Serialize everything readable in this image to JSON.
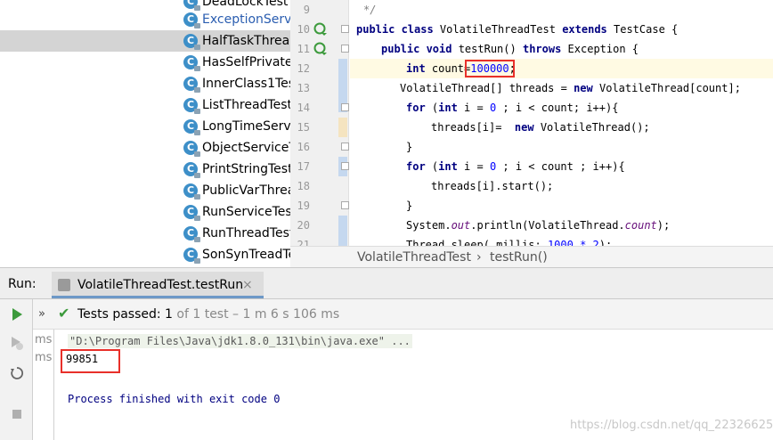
{
  "project_tree": {
    "items": [
      {
        "label": "DeadLockTest",
        "blue": false,
        "selected": false
      },
      {
        "label": "ExceptionServi",
        "blue": true,
        "selected": false
      },
      {
        "label": "HalfTaskThrea",
        "blue": false,
        "selected": true
      },
      {
        "label": "HasSelfPrivate",
        "blue": false,
        "selected": false
      },
      {
        "label": "InnerClass1Tes",
        "blue": false,
        "selected": false
      },
      {
        "label": "ListThreadTest",
        "blue": false,
        "selected": false
      },
      {
        "label": "LongTimeServi",
        "blue": false,
        "selected": false
      },
      {
        "label": "ObjectServiceT",
        "blue": false,
        "selected": false
      },
      {
        "label": "PrintStringTest",
        "blue": false,
        "selected": false
      },
      {
        "label": "PublicVarThrea",
        "blue": false,
        "selected": false
      },
      {
        "label": "RunServiceTes",
        "blue": false,
        "selected": false
      },
      {
        "label": "RunThreadTest",
        "blue": false,
        "selected": false
      },
      {
        "label": "SonSynTreadTe",
        "blue": false,
        "selected": false
      }
    ],
    "class_glyph": "C"
  },
  "editor": {
    "line_numbers": [
      "9",
      "10",
      "11",
      "12",
      "13",
      "14",
      "15",
      "16",
      "17",
      "18",
      "19",
      "20",
      "21"
    ],
    "code": {
      "l9_comment": "*/",
      "l10_kw1": "public class",
      "l10_name": " VolatileThreadTest ",
      "l10_kw2": "extends",
      "l10_rest": " TestCase {",
      "l11_kw1": "public void",
      "l11_name": " testRun() ",
      "l11_kw2": "throws",
      "l11_rest": " Exception {",
      "l12_kw": "int",
      "l12_name": " count=",
      "l12_num": "100000",
      "l12_rest": ";",
      "l13_pre": "VolatileThread[] threads = ",
      "l13_kw": "new",
      "l13_rest": " VolatileThread[count];",
      "l14_kw": "for",
      "l14_a": " (",
      "l14_kw2": "int",
      "l14_b": " i = ",
      "l14_num": "0",
      "l14_c": " ; i < count; i++){",
      "l15_pre": "threads[i]=  ",
      "l15_kw": "new",
      "l15_rest": " VolatileThread();",
      "l16": "}",
      "l17_kw": "for",
      "l17_a": " (",
      "l17_kw2": "int",
      "l17_b": " i = ",
      "l17_num": "0",
      "l17_c": " ; i < count ; i++){",
      "l18": "threads[i].start();",
      "l19": "}",
      "l20_pre": "System.",
      "l20_fld": "out",
      "l20_mid": ".println(VolatileThread.",
      "l20_fld2": "count",
      "l20_rest": ");",
      "l21_pre": "Thread.sleep( millis: ",
      "l21_num": "1000 * 2",
      "l21_rest": ");"
    }
  },
  "breadcrumb": {
    "class": "VolatileThreadTest",
    "separator": "›",
    "method": "testRun()"
  },
  "run_panel": {
    "title": "Run:",
    "tab_label": "VolatileThreadTest.testRun",
    "tab_close": "×",
    "expand": "»",
    "check": "✔",
    "status_bold": "Tests passed: 1",
    "status_gray": " of 1 test – 1 m 6 s 106 ms",
    "ms_labels": [
      "ms",
      "ms"
    ]
  },
  "console": {
    "command": "\"D:\\Program Files\\Java\\jdk1.8.0_131\\bin\\java.exe\" ...",
    "output": "99851",
    "finished": "Process finished with exit code 0",
    "watermark": "https://blog.csdn.net/qq_22326625"
  },
  "colors": {
    "accent_blue": "#2a5db0",
    "highlight_red": "#e8302a",
    "keyword": "#000080",
    "number": "#0000ff",
    "pass_green": "#3c9a3c"
  }
}
